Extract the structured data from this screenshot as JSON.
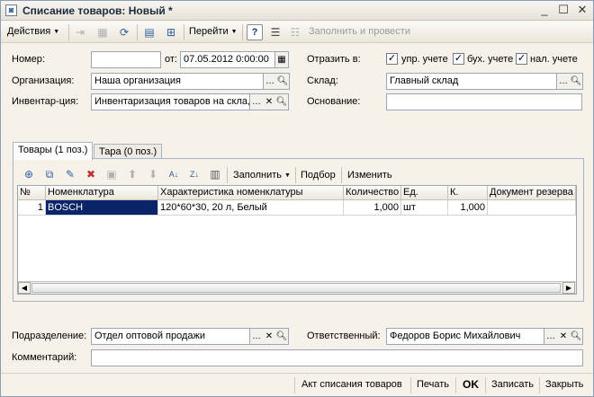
{
  "window": {
    "title": "Списание товаров: Новый *",
    "minimize": "_",
    "maximize": "☐",
    "close": "✕"
  },
  "toolbar": {
    "actions_label": "Действия",
    "goto_label": "Перейти",
    "help_label": "?",
    "fill_and_post_label": "Заполнить и провести"
  },
  "header": {
    "number_label": "Номер:",
    "number_value": "",
    "from_label": "от:",
    "date_value": "07.05.2012  0:00:00",
    "reflect_label": "Отразить в:",
    "reflect_options": [
      {
        "label": "упр. учете",
        "checked": true
      },
      {
        "label": "бух. учете",
        "checked": true
      },
      {
        "label": "нал. учете",
        "checked": true
      }
    ],
    "organization_label": "Организация:",
    "organization_value": "Наша организация",
    "warehouse_label": "Склад:",
    "warehouse_value": "Главный склад",
    "inventory_label": "Инвентар-ция:",
    "inventory_value": "Инвентаризация товаров на скла,",
    "basis_label": "Основание:",
    "basis_value": ""
  },
  "tabs": [
    {
      "label": "Товары (1 поз.)",
      "active": true
    },
    {
      "label": "Тара (0 поз.)",
      "active": false
    }
  ],
  "table_toolbar": {
    "fill_label": "Заполнить",
    "select_label": "Подбор",
    "change_label": "Изменить"
  },
  "table": {
    "columns": [
      "№",
      "Номенклатура",
      "Характеристика номенклатуры",
      "Количество",
      "Ед.",
      "К.",
      "Документ резерва"
    ],
    "rows": [
      [
        "1",
        "BOSCH",
        "120*60*30, 20 л, Белый",
        "1,000",
        "шт",
        "1,000",
        ""
      ]
    ]
  },
  "footer_fields": {
    "department_label": "Подразделение:",
    "department_value": "Отдел оптовой продажи",
    "responsible_label": "Ответственный:",
    "responsible_value": "Федоров Борис Михайлович",
    "comment_label": "Комментарий:",
    "comment_value": ""
  },
  "bottom_buttons": {
    "act_label": "Акт списания товаров",
    "print_label": "Печать",
    "ok_label": "OK",
    "save_label": "Записать",
    "close_label": "Закрыть"
  },
  "colors": {
    "selection": "#0a246a",
    "window_bg": "#f6f2ea"
  }
}
